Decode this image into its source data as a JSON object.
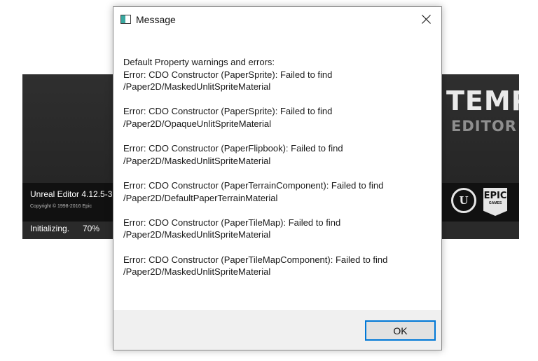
{
  "splash": {
    "title_big": "TEMP",
    "title_sub": "EDITOR",
    "editor_version": "Unreal Editor 4.12.5-3",
    "copyright": "Copyright © 1998-2016   Epic",
    "status": "Initializing.",
    "progress_percent": "70%",
    "ue_logo_text": "U",
    "epic_logo_line1": "EPIC",
    "epic_logo_line2": "GAMES"
  },
  "dialog": {
    "title": "Message",
    "lines": [
      "Default Property warnings and errors:",
      "Error: CDO Constructor (PaperSprite): Failed to find",
      "/Paper2D/MaskedUnlitSpriteMaterial",
      "",
      "Error: CDO Constructor (PaperSprite): Failed to find",
      "/Paper2D/OpaqueUnlitSpriteMaterial",
      "",
      "Error: CDO Constructor (PaperFlipbook): Failed to find",
      "/Paper2D/MaskedUnlitSpriteMaterial",
      "",
      "Error: CDO Constructor (PaperTerrainComponent): Failed to find",
      "/Paper2D/DefaultPaperTerrainMaterial",
      "",
      "Error: CDO Constructor (PaperTileMap): Failed to find",
      "/Paper2D/MaskedUnlitSpriteMaterial",
      "",
      "Error: CDO Constructor (PaperTileMapComponent): Failed to find",
      "/Paper2D/MaskedUnlitSpriteMaterial"
    ],
    "ok_label": "OK"
  },
  "colors": {
    "accent_focus": "#0078d7",
    "footer_bg": "#f0f0f0",
    "splash_bg": "#2a2a2a"
  }
}
